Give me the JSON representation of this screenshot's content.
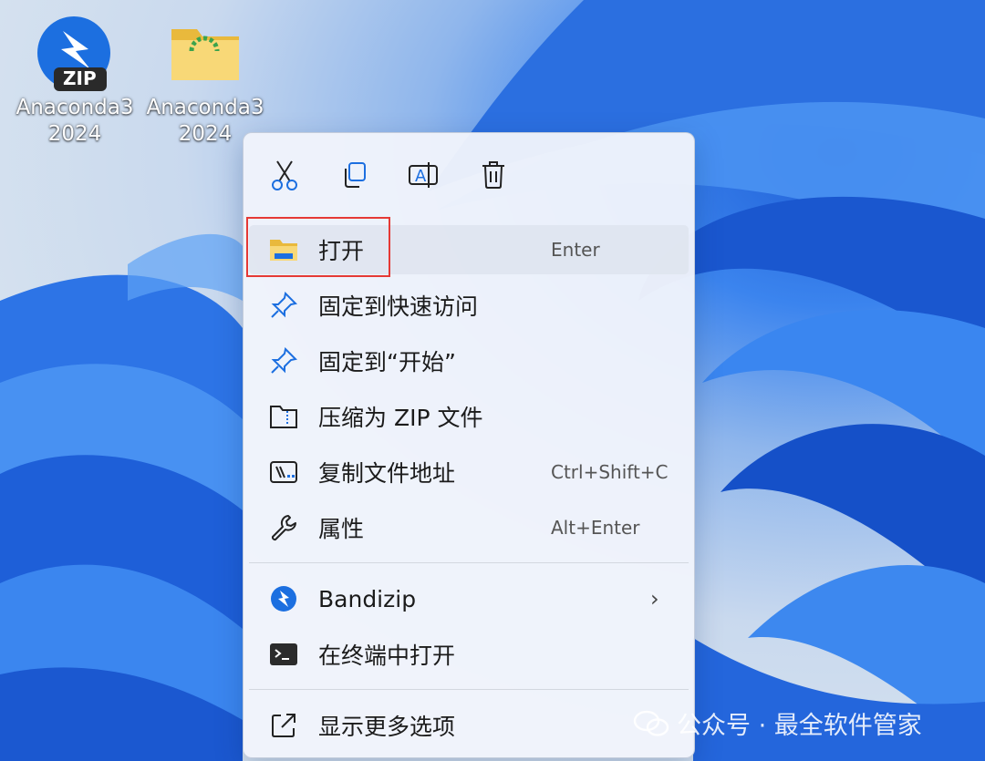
{
  "desktop": {
    "icons": [
      {
        "name": "Anaconda3 2024",
        "line1": "Anaconda3",
        "line2": "2024",
        "badge": "ZIP",
        "icon": "bandizip-zip-icon"
      },
      {
        "name": "Anaconda3 2024",
        "line1": "Anaconda3",
        "line2": "2024",
        "icon": "folder-icon"
      }
    ]
  },
  "context_menu": {
    "toolbar": [
      "cut-icon",
      "copy-icon",
      "rename-icon",
      "delete-icon"
    ],
    "items": [
      {
        "label": "打开",
        "shortcut": "Enter",
        "icon": "folder-open-icon",
        "highlighted": true
      },
      {
        "label": "固定到快速访问",
        "shortcut": "",
        "icon": "pin-icon"
      },
      {
        "label": "固定到“开始”",
        "shortcut": "",
        "icon": "pin-icon"
      },
      {
        "label": "压缩为 ZIP 文件",
        "shortcut": "",
        "icon": "zip-folder-icon"
      },
      {
        "label": "复制文件地址",
        "shortcut": "Ctrl+Shift+C",
        "icon": "copy-path-icon"
      },
      {
        "label": "属性",
        "shortcut": "Alt+Enter",
        "icon": "wrench-icon"
      },
      {
        "label": "Bandizip",
        "shortcut": "",
        "icon": "bandizip-icon",
        "submenu": true
      },
      {
        "label": "在终端中打开",
        "shortcut": "",
        "icon": "terminal-icon"
      },
      {
        "label": "显示更多选项",
        "shortcut": "",
        "icon": "more-options-icon"
      }
    ],
    "submenu_glyph": "›"
  },
  "watermark": {
    "text": "公众号 · 最全软件管家"
  },
  "colors": {
    "highlight_border": "#e53935",
    "accent_blue": "#1c6fe0"
  }
}
